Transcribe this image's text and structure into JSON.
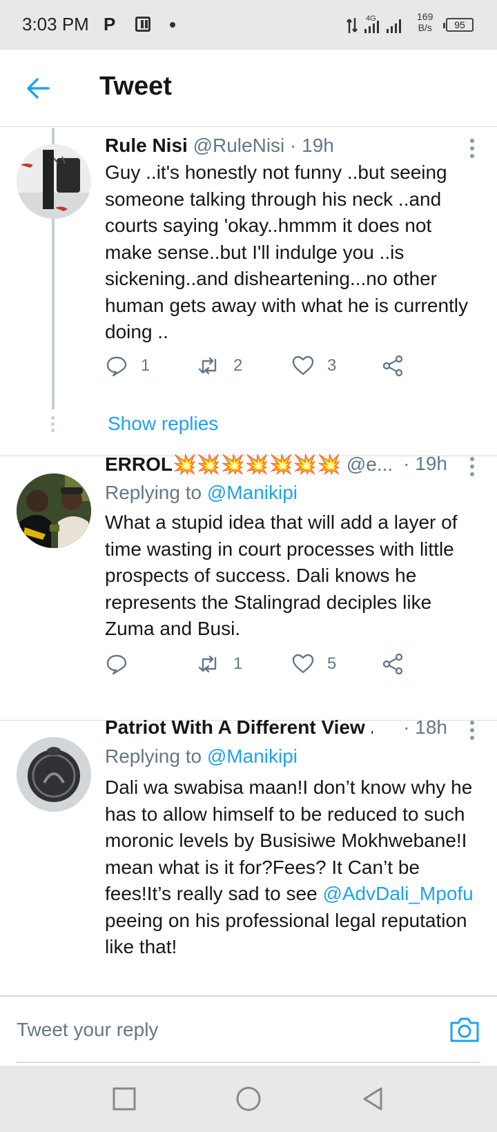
{
  "status_bar": {
    "time": "3:03 PM",
    "network": "4G",
    "rate_value": "169",
    "rate_unit": "B/s",
    "battery": "95"
  },
  "header": {
    "title": "Tweet"
  },
  "tweets": [
    {
      "name": "Rule Nisi",
      "handle": "@RuleNisi",
      "separator": "·",
      "time": "19h",
      "text": "Guy ..it's honestly not funny ..but seeing someone talking through his neck ..and courts saying 'okay..hmmm it does not make sense..but I'll indulge you ..is sickening..and disheartening...no other human gets away with what he is currently doing ..",
      "replies": "1",
      "retweets": "2",
      "likes": "3",
      "show_replies": "Show replies"
    },
    {
      "name": "ERROL💥💥💥💥💥💥💥",
      "handle": "@e...",
      "separator": "·",
      "time": "19h",
      "replying_prefix": "Replying to",
      "replying_to": "@Manikipi",
      "text": "What a stupid idea that will add a layer of time wasting in court processes with little prospects of success. Dali knows he represents the Stalingrad deciples like Zuma and Busi.",
      "replies": "",
      "retweets": "1",
      "likes": "5"
    },
    {
      "name": "Patriot With A Different View ...",
      "separator": "·",
      "time": "18h",
      "replying_prefix": "Replying to",
      "replying_to": "@Manikipi",
      "text_before": "Dali wa swabisa maan!I don’t know why he has to allow himself to be reduced to such moronic levels by Busisiwe Mokhwebane!I mean what is it for?Fees? It Can’t be fees!It’s really sad to see ",
      "mention": "@AdvDali_Mpofu",
      "text_after": " peeing on his professional legal reputation like that!"
    }
  ],
  "reply_bar": {
    "placeholder": "Tweet your reply"
  },
  "colors": {
    "accent": "#1da1f2",
    "muted": "#657786",
    "text": "#14171a",
    "divider": "#d6dbdf"
  },
  "icons": [
    "back-arrow-icon",
    "more-vertical-icon",
    "reply-icon",
    "retweet-icon",
    "like-icon",
    "share-icon",
    "camera-icon",
    "nav-recent-icon",
    "nav-home-icon",
    "nav-back-icon"
  ]
}
